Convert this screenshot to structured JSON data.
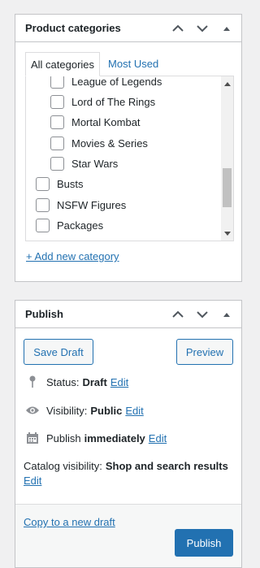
{
  "categories_panel": {
    "title": "Product categories",
    "tabs": {
      "all": "All categories",
      "most_used": "Most Used"
    },
    "items": [
      {
        "label": "League of Legends"
      },
      {
        "label": "Lord of The Rings"
      },
      {
        "label": "Mortal Kombat"
      },
      {
        "label": "Movies & Series"
      },
      {
        "label": "Star Wars"
      },
      {
        "label": "Busts"
      },
      {
        "label": "NSFW Figures"
      },
      {
        "label": "Packages"
      }
    ],
    "add_link": "+ Add new category"
  },
  "publish_panel": {
    "title": "Publish",
    "save_draft": "Save Draft",
    "preview": "Preview",
    "status_label": "Status:",
    "status_value": "Draft",
    "visibility_label": "Visibility:",
    "visibility_value": "Public",
    "publish_label": "Publish",
    "publish_value": "immediately",
    "edit": "Edit",
    "catalog_label": "Catalog visibility:",
    "catalog_value": "Shop and search results",
    "copy_draft": "Copy to a new draft",
    "publish_button": "Publish"
  },
  "colors": {
    "accent": "#2271b1",
    "border": "#c3c4c7"
  },
  "icons": [
    "chevron-up-icon",
    "chevron-down-icon",
    "triangle-up-icon",
    "pin-icon",
    "eye-icon",
    "calendar-icon"
  ]
}
